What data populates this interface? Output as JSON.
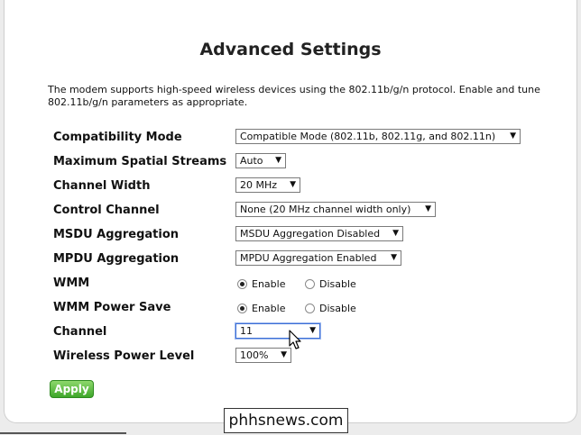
{
  "title": "Advanced Settings",
  "intro": "The modem supports high-speed wireless devices using the 802.11b/g/n protocol. Enable and tune 802.11b/g/n parameters as appropriate.",
  "fields": {
    "compat_mode": {
      "label": "Compatibility Mode",
      "value": "Compatible Mode (802.11b, 802.11g, and 802.11n)"
    },
    "spatial_streams": {
      "label": "Maximum Spatial Streams",
      "value": "Auto"
    },
    "channel_width": {
      "label": "Channel Width",
      "value": "20 MHz"
    },
    "control_channel": {
      "label": "Control Channel",
      "value": "None (20 MHz channel width only)"
    },
    "msdu": {
      "label": "MSDU Aggregation",
      "value": "MSDU Aggregation Disabled"
    },
    "mpdu": {
      "label": "MPDU Aggregation",
      "value": "MPDU Aggregation Enabled"
    },
    "wmm": {
      "label": "WMM",
      "enable": "Enable",
      "disable": "Disable",
      "selected": "Enable"
    },
    "wmm_power_save": {
      "label": "WMM Power Save",
      "enable": "Enable",
      "disable": "Disable",
      "selected": "Enable"
    },
    "channel": {
      "label": "Channel",
      "value": "11"
    },
    "power_level": {
      "label": "Wireless Power Level",
      "value": "100%"
    }
  },
  "apply_label": "Apply",
  "dropdown_arrow": "▼",
  "watermark": "phhsnews.com"
}
